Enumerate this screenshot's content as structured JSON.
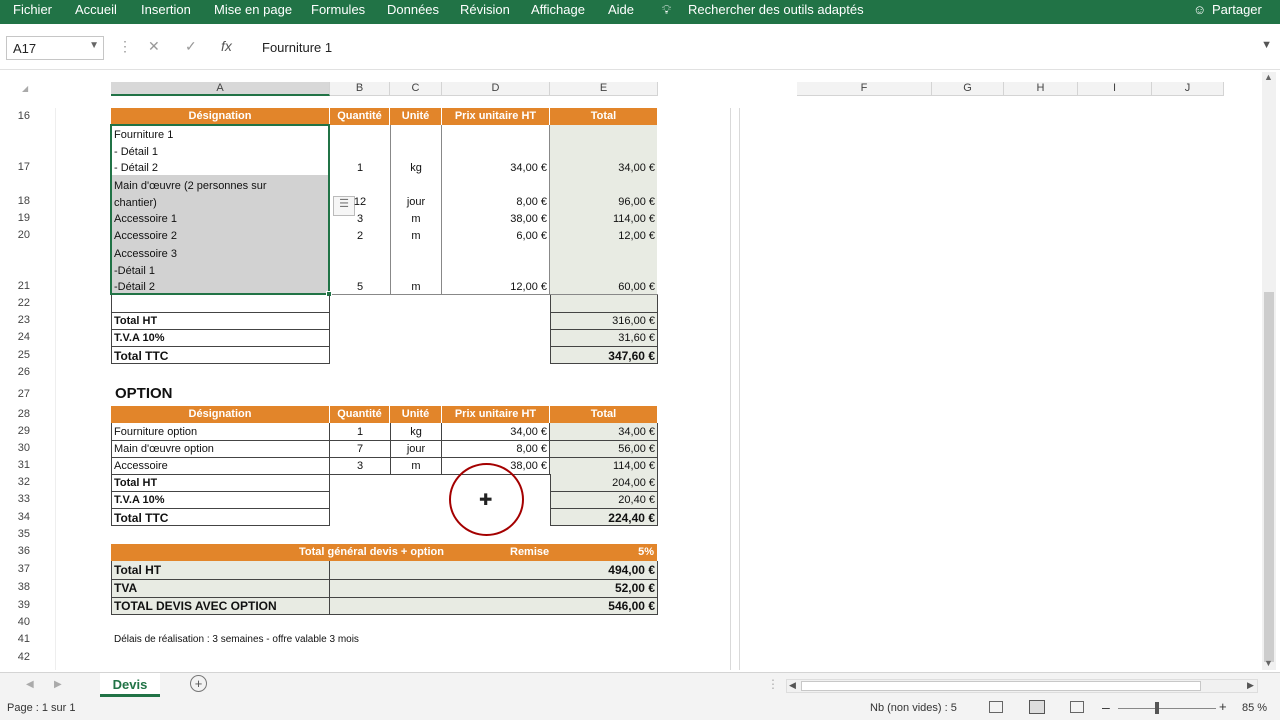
{
  "ribbon": {
    "menus": [
      "Fichier",
      "Accueil",
      "Insertion",
      "Mise en page",
      "Formules",
      "Données",
      "Révision",
      "Affichage",
      "Aide"
    ],
    "tell_me": "Rechercher des outils adaptés",
    "share": "Partager"
  },
  "formula_bar": {
    "name_box": "A17",
    "formula": "Fourniture 1"
  },
  "columns": [
    "A",
    "B",
    "C",
    "D",
    "E",
    "F",
    "G",
    "H",
    "I",
    "J"
  ],
  "rows": [
    "16",
    "17",
    "18",
    "19",
    "20",
    "21",
    "22",
    "23",
    "24",
    "25",
    "26",
    "27",
    "28",
    "29",
    "30",
    "31",
    "32",
    "33",
    "34",
    "35",
    "36",
    "37",
    "38",
    "39",
    "40",
    "41",
    "42"
  ],
  "table_headers": [
    "Désignation",
    "Quantité",
    "Unité",
    "Prix unitaire HT",
    "Total"
  ],
  "main_cells": {
    "a17": [
      "Fourniture 1",
      "- Détail 1",
      "- Détail 2"
    ],
    "a18": [
      "Main d'œuvre (2 personnes sur",
      "chantier)"
    ],
    "a19": "Accessoire 1",
    "a20": "Accessoire 2",
    "a21": [
      "Accessoire 3",
      "-Détail 1",
      "-Détail 2"
    ],
    "qty": [
      "1",
      "12",
      "3",
      "2",
      "5"
    ],
    "unit": [
      "kg",
      "jour",
      "m",
      "m",
      "m"
    ],
    "price": [
      "34,00 €",
      "8,00 €",
      "38,00 €",
      "6,00 €",
      "12,00 €"
    ],
    "total": [
      "34,00 €",
      "96,00 €",
      "114,00 €",
      "12,00 €",
      "60,00 €"
    ]
  },
  "totals": {
    "labels": [
      "Total HT",
      "T.V.A 10%",
      "Total TTC"
    ],
    "values": [
      "316,00 €",
      "31,60 €",
      "347,60 €"
    ]
  },
  "option": {
    "title": "OPTION",
    "rows": [
      {
        "d": "Fourniture option",
        "q": "1",
        "u": "kg",
        "p": "34,00 €",
        "t": "34,00 €"
      },
      {
        "d": "Main d'œuvre option",
        "q": "7",
        "u": "jour",
        "p": "8,00 €",
        "t": "56,00 €"
      },
      {
        "d": "Accessoire",
        "q": "3",
        "u": "m",
        "p": "38,00 €",
        "t": "114,00 €"
      }
    ],
    "total_labels": [
      "Total HT",
      "T.V.A 10%",
      "Total TTC"
    ],
    "total_values": [
      "204,00 €",
      "20,40 €",
      "224,40 €"
    ]
  },
  "general": {
    "header": "Total général devis + option",
    "remise_label": "Remise",
    "remise_value": "5%",
    "labels": [
      "Total HT",
      "TVA",
      "TOTAL DEVIS AVEC OPTION"
    ],
    "values": [
      "494,00 €",
      "52,00 €",
      "546,00 €"
    ]
  },
  "note": "Délais de réalisation : 3 semaines - offre valable 3 mois",
  "sheet_tab": "Devis",
  "status": {
    "page": "Page : 1 sur 1",
    "count": "Nb (non vides) : 5",
    "zoom": "85 %"
  }
}
